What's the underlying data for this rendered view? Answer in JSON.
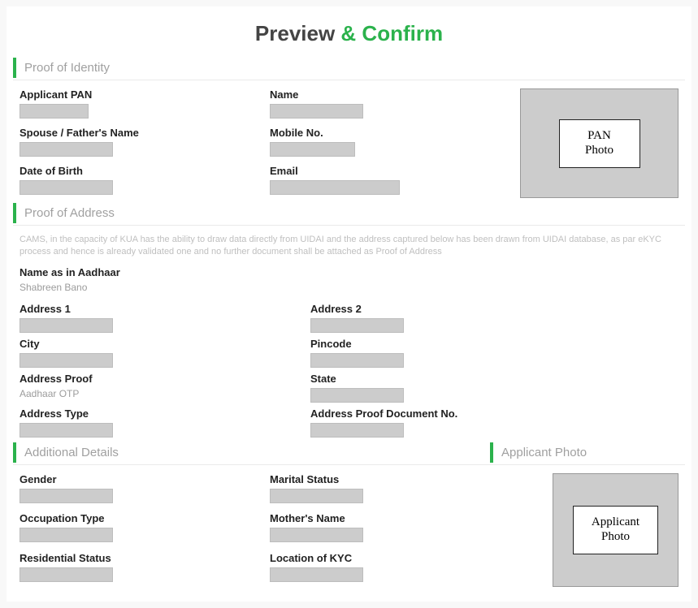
{
  "title": {
    "prefix": "Preview ",
    "accent": "& Confirm"
  },
  "sections": {
    "identity": {
      "heading": "Proof of Identity",
      "fields": {
        "pan_label": "Applicant PAN",
        "name_label": "Name",
        "spouse_label": "Spouse / Father's Name",
        "mobile_label": "Mobile No.",
        "dob_label": "Date of Birth",
        "email_label": "Email"
      },
      "photo_label": "PAN\nPhoto"
    },
    "address": {
      "heading": "Proof of Address",
      "note": "CAMS, in the capacity of KUA has the ability to draw data directly from UIDAI and the address captured below has been drawn from UIDAI database, as par eKYC process and hence is already validated one and no further document shall be attached as Proof of Address",
      "aadhaar_name_label": "Name as in Aadhaar",
      "aadhaar_name_value": "Shabreen Bano",
      "fields": {
        "addr1_label": "Address 1",
        "addr2_label": "Address 2",
        "city_label": "City",
        "pincode_label": "Pincode",
        "proof_label": "Address Proof",
        "proof_value": "Aadhaar OTP",
        "state_label": "State",
        "addrtype_label": "Address Type",
        "docno_label": "Address Proof Document No."
      }
    },
    "additional": {
      "heading": "Additional Details",
      "fields": {
        "gender_label": "Gender",
        "marital_label": "Marital Status",
        "occupation_label": "Occupation Type",
        "mother_label": "Mother's Name",
        "residential_label": "Residential Status",
        "location_label": "Location of KYC"
      }
    },
    "applicant_photo": {
      "heading": "Applicant Photo",
      "photo_label": "Applicant\nPhoto"
    }
  }
}
